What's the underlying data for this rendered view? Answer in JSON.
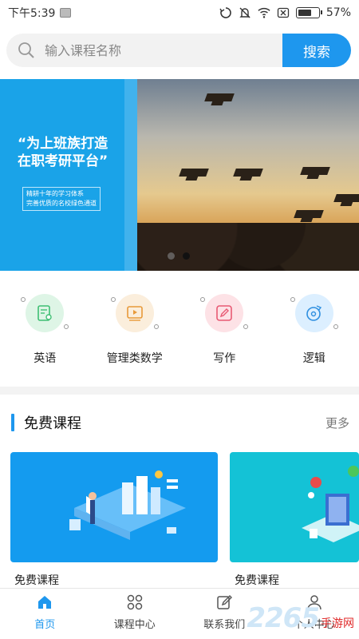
{
  "status_bar": {
    "time": "下午5:39",
    "battery": "57%"
  },
  "search": {
    "placeholder": "输入课程名称",
    "button": "搜索"
  },
  "banner": {
    "title_line1": "“为上班族打造",
    "title_line2": "在职考研平台”",
    "sub_line1": "精耕十年的学习体系",
    "sub_line2": "完善优质的名校绿色通道",
    "active_slide": 2,
    "slide_count": 2
  },
  "categories": [
    {
      "label": "英语",
      "icon": "certificate-icon",
      "color": "#def5e6",
      "stroke": "#3fbf73"
    },
    {
      "label": "管理类数学",
      "icon": "video-icon",
      "color": "#fbeedc",
      "stroke": "#e89a3a"
    },
    {
      "label": "写作",
      "icon": "edit-icon",
      "color": "#fde2e6",
      "stroke": "#e85a74"
    },
    {
      "label": "逻辑",
      "icon": "disc-icon",
      "color": "#dcefff",
      "stroke": "#2e8fe0"
    }
  ],
  "free_courses": {
    "title": "免费课程",
    "more": "更多",
    "items": [
      {
        "label": "免费课程"
      },
      {
        "label": "免费课程"
      }
    ]
  },
  "tabbar": {
    "items": [
      {
        "label": "首页",
        "icon": "home-icon",
        "active": true
      },
      {
        "label": "课程中心",
        "icon": "grid-icon",
        "active": false
      },
      {
        "label": "联系我们",
        "icon": "edit-note-icon",
        "active": false
      },
      {
        "label": "个人中心",
        "icon": "user-icon",
        "active": false
      }
    ]
  },
  "watermark": {
    "number": "2265",
    "text": "手游网"
  },
  "colors": {
    "accent": "#1e97ee",
    "banner_blue": "#1aa3e8"
  }
}
